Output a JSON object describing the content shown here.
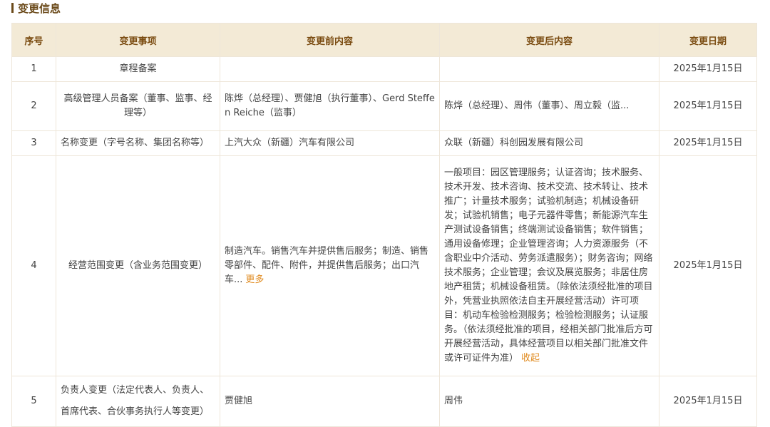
{
  "section": {
    "title": "变更信息"
  },
  "table": {
    "headers": [
      "序号",
      "变更事项",
      "变更前内容",
      "变更后内容",
      "变更日期"
    ],
    "rows": [
      {
        "index": "1",
        "item": "章程备案",
        "before": "",
        "after": "",
        "date": "2025年1月15日"
      },
      {
        "index": "2",
        "item": "高级管理人员备案（董事、监事、经理等）",
        "before": "陈烨（总经理）、贾健旭（执行董事）、Gerd Steffen Reiche（监事）",
        "after": "陈烨（总经理）、周伟（董事）、周立毅（监...",
        "date": "2025年1月15日"
      },
      {
        "index": "3",
        "item": "名称变更（字号名称、集团名称等）",
        "before": "上汽大众（新疆）汽车有限公司",
        "after": "众联（新疆）科创园发展有限公司",
        "date": "2025年1月15日"
      },
      {
        "index": "4",
        "item": "经营范围变更（含业务范围变更）",
        "before": "制造汽车。销售汽车并提供售后服务；制造、销售零部件、配件、附件，并提供售后服务；出口汽车...",
        "before_link": "更多",
        "after": "一般项目：园区管理服务；认证咨询；技术服务、技术开发、技术咨询、技术交流、技术转让、技术推广；计量技术服务；试验机制造；机械设备研发；试验机销售；电子元器件零售；新能源汽车生产测试设备销售；终端测试设备销售；软件销售；通用设备修理；企业管理咨询；人力资源服务（不含职业中介活动、劳务派遣服务）；财务咨询；网络技术服务；企业管理；会议及展览服务；非居住房地产租赁；机械设备租赁。（除依法须经批准的项目外，凭营业执照依法自主开展经营活动）许可项目：机动车检验检测服务；检验检测服务；认证服务。（依法须经批准的项目，经相关部门批准后方可开展经营活动，具体经营项目以相关部门批准文件或许可证件为准）",
        "after_link": "收起",
        "date": "2025年1月15日"
      },
      {
        "index": "5",
        "item": "负责人变更（法定代表人、负责人、首席代表、合伙事务执行人等变更）",
        "before": "贾健旭",
        "after": "周伟",
        "date": "2025年1月15日"
      }
    ]
  }
}
